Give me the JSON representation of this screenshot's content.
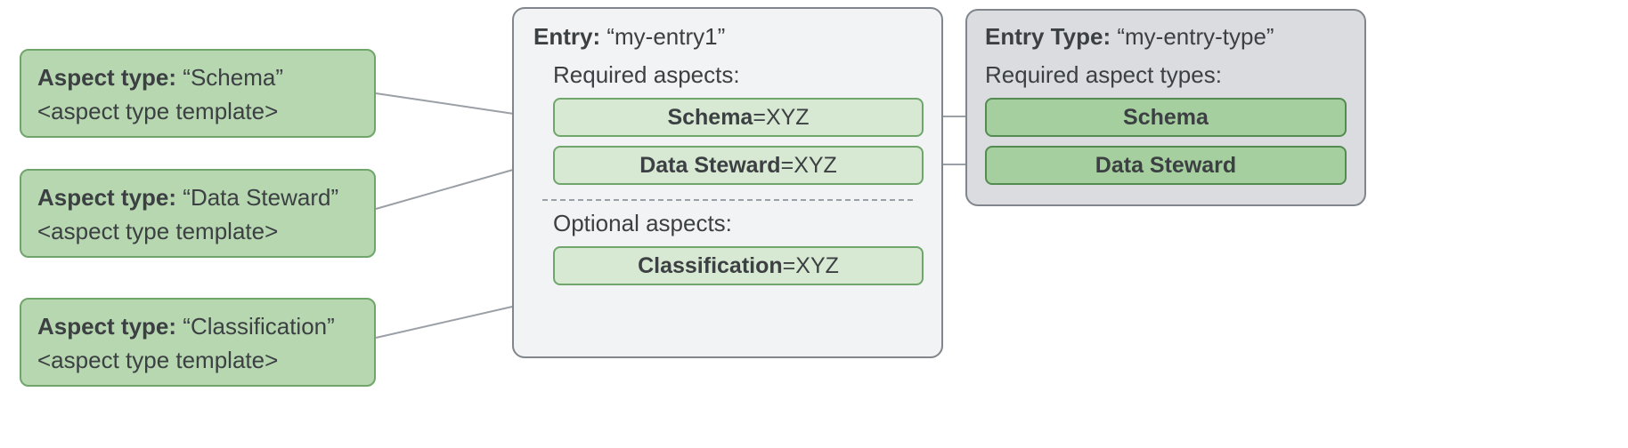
{
  "aspect_types": [
    {
      "label": "Aspect type:",
      "name": "“Schema”",
      "template": "<aspect type template>"
    },
    {
      "label": "Aspect type:",
      "name": "“Data Steward”",
      "template": "<aspect type template>"
    },
    {
      "label": "Aspect type:",
      "name": "“Classification”",
      "template": "<aspect type template>"
    }
  ],
  "entry": {
    "header_label": "Entry:",
    "header_value": "“my-entry1”",
    "required_label": "Required aspects:",
    "required": [
      {
        "name": "Schema",
        "eq": " = ",
        "value": "XYZ"
      },
      {
        "name": "Data Steward",
        "eq": " = ",
        "value": "XYZ"
      }
    ],
    "optional_label": "Optional aspects:",
    "optional": [
      {
        "name": "Classification",
        "eq": " = ",
        "value": "XYZ"
      }
    ]
  },
  "entry_type": {
    "header_label": "Entry Type:",
    "header_value": "“my-entry-type”",
    "required_label": "Required aspect types:",
    "required": [
      {
        "name": "Schema"
      },
      {
        "name": "Data Steward"
      }
    ]
  }
}
